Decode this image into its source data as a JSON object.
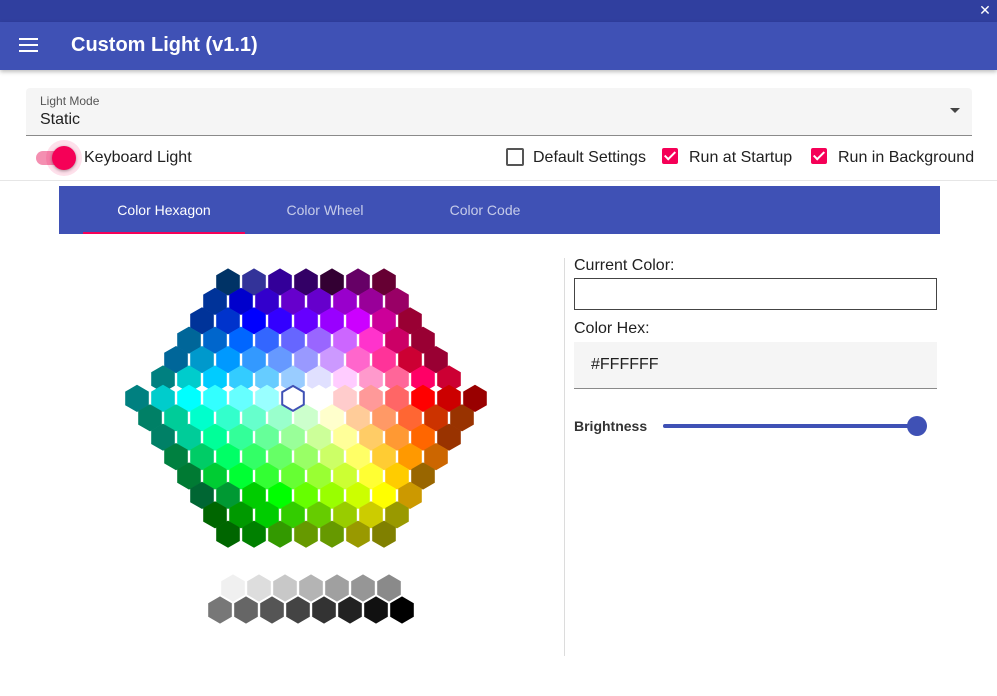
{
  "window": {
    "close_glyph": "✕"
  },
  "appbar": {
    "title": "Custom Light (v1.1)",
    "menu_icon": "hamburger-menu-icon"
  },
  "light_mode": {
    "label": "Light Mode",
    "value": "Static"
  },
  "options": {
    "keyboard_light": {
      "label": "Keyboard Light",
      "on": true
    },
    "default_settings": {
      "label": "Default Settings",
      "checked": false
    },
    "run_at_startup": {
      "label": "Run at Startup",
      "checked": true
    },
    "run_in_background": {
      "label": "Run in Background",
      "checked": true
    }
  },
  "tabs": [
    {
      "label": "Color Hexagon",
      "active": true
    },
    {
      "label": "Color Wheel",
      "active": false
    },
    {
      "label": "Color Code",
      "active": false
    }
  ],
  "color_panel": {
    "current_color_label": "Current Color:",
    "current_color": "#FFFFFF",
    "hex_label": "Color Hex:",
    "hex_value": "#FFFFFF",
    "brightness_label": "Brightness",
    "brightness": 1.0
  },
  "hexagon": {
    "selected_color": "#FFFFFF",
    "rows": [
      [
        "#003366",
        "#333399",
        "#330099",
        "#330066",
        "#330033",
        "#660066",
        "#660033"
      ],
      [
        "#003399",
        "#0000CC",
        "#3300CC",
        "#6600CC",
        "#6600CC",
        "#9900CC",
        "#990099",
        "#990066"
      ],
      [
        "#003399",
        "#0033CC",
        "#0000FF",
        "#3300FF",
        "#6600FF",
        "#9900FF",
        "#CC00FF",
        "#CC0099",
        "#990033"
      ],
      [
        "#006699",
        "#0066CC",
        "#0066FF",
        "#3366FF",
        "#6666FF",
        "#9966FF",
        "#CC66FF",
        "#FF33CC",
        "#CC0066",
        "#990033"
      ],
      [
        "#006699",
        "#0099CC",
        "#0099FF",
        "#3399FF",
        "#6699FF",
        "#9999FF",
        "#CC99FF",
        "#FF66CC",
        "#FF3399",
        "#CC0033",
        "#990033"
      ],
      [
        "#008080",
        "#00CCCC",
        "#00CCFF",
        "#33CCFF",
        "#66CCFF",
        "#99CCFF",
        "#E0E0FF",
        "#FFCCFF",
        "#FF99CC",
        "#FF6699",
        "#FF0066",
        "#CC0033"
      ],
      [
        "#008080",
        "#00CCCC",
        "#00FFFF",
        "#33FFFF",
        "#66FFFF",
        "#99FFFF",
        "#FFFFFF",
        "#FFFFFF",
        "#FFCCCC",
        "#FF9999",
        "#FF6666",
        "#FF0000",
        "#CC0000",
        "#990000"
      ],
      [
        "#008066",
        "#00CC99",
        "#00FFCC",
        "#33FFCC",
        "#66FFCC",
        "#99FFCC",
        "#CCFFCC",
        "#FFFFCC",
        "#FFCC99",
        "#FF9966",
        "#FF6633",
        "#CC3300",
        "#993300"
      ],
      [
        "#008066",
        "#00CC99",
        "#00FF99",
        "#33FF99",
        "#66FF99",
        "#99FF99",
        "#CCFF99",
        "#FFFF99",
        "#FFCC66",
        "#FF9933",
        "#FF6600",
        "#993300"
      ],
      [
        "#008040",
        "#00CC66",
        "#00FF66",
        "#33FF66",
        "#66FF66",
        "#99FF66",
        "#CCFF66",
        "#FFFF66",
        "#FFCC33",
        "#FF9900",
        "#CC6600"
      ],
      [
        "#007A33",
        "#00CC33",
        "#00FF33",
        "#33FF33",
        "#66FF33",
        "#99FF33",
        "#CCFF33",
        "#FFFF33",
        "#FFCC00",
        "#996600"
      ],
      [
        "#006633",
        "#009933",
        "#00CC00",
        "#00FF00",
        "#66FF00",
        "#99FF00",
        "#CCFF00",
        "#FFFF00",
        "#CC9900"
      ],
      [
        "#006600",
        "#009900",
        "#00CC00",
        "#33CC00",
        "#66CC00",
        "#99CC00",
        "#CCCC00",
        "#999900"
      ],
      [
        "#006600",
        "#008000",
        "#339900",
        "#669900",
        "#669900",
        "#999900",
        "#808000"
      ]
    ],
    "grays_top": [
      "#F0F0F0",
      "#DDDDDD",
      "#C8C8C8",
      "#B4B4B4",
      "#A0A0A0",
      "#969696",
      "#8A8A8A"
    ],
    "grays_bottom": [
      "#777777",
      "#666666",
      "#555555",
      "#444444",
      "#333333",
      "#222222",
      "#111111",
      "#000000"
    ]
  }
}
